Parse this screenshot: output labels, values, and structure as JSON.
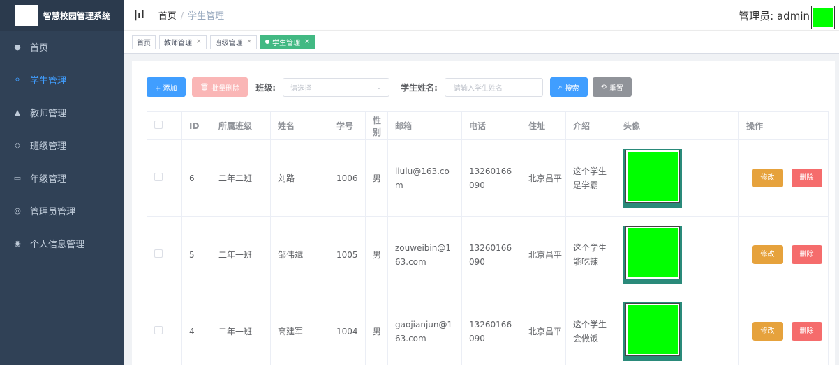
{
  "sidebar": {
    "app_title": "智慧校园管理系统",
    "items": [
      {
        "label": "首页",
        "icon": "dashboard-icon"
      },
      {
        "label": "学生管理",
        "icon": "user-icon"
      },
      {
        "label": "教师管理",
        "icon": "people-icon"
      },
      {
        "label": "班级管理",
        "icon": "tag-icon"
      },
      {
        "label": "年级管理",
        "icon": "calendar-icon"
      },
      {
        "label": "管理员管理",
        "icon": "peoples-icon"
      },
      {
        "label": "个人信息管理",
        "icon": "info-icon"
      }
    ]
  },
  "header": {
    "breadcrumb_home": "首页",
    "breadcrumb_sep": "/",
    "breadcrumb_current": "学生管理",
    "admin_label": "管理员: admin"
  },
  "tags": [
    {
      "label": "首页"
    },
    {
      "label": "教师管理"
    },
    {
      "label": "班级管理"
    },
    {
      "label": "学生管理"
    }
  ],
  "toolbar": {
    "add_label": "+ 添加",
    "batch_delete_label": "批量删除",
    "class_label": "班级:",
    "class_placeholder": "请选择",
    "name_label": "学生姓名:",
    "name_placeholder": "请输入学生姓名",
    "search_label": "搜索",
    "reset_label": "重置"
  },
  "table": {
    "headers": [
      "ID",
      "所属班级",
      "姓名",
      "学号",
      "性别",
      "邮箱",
      "电话",
      "住址",
      "介绍",
      "头像",
      "操作"
    ],
    "rows": [
      {
        "id": "6",
        "class": "二年二班",
        "name": "刘路",
        "number": "1006",
        "gender": "男",
        "email": "liulu@163.com",
        "phone": "13260166090",
        "address": "北京昌平",
        "intro": "这个学生是学霸"
      },
      {
        "id": "5",
        "class": "二年一班",
        "name": "邹伟斌",
        "number": "1005",
        "gender": "男",
        "email": "zouweibin@163.com",
        "phone": "13260166090",
        "address": "北京昌平",
        "intro": "这个学生能吃辣"
      },
      {
        "id": "4",
        "class": "二年一班",
        "name": "高建军",
        "number": "1004",
        "gender": "男",
        "email": "gaojianjun@163.com",
        "phone": "13260166090",
        "address": "北京昌平",
        "intro": "这个学生会做饭"
      }
    ],
    "edit_label": "修改",
    "delete_label": "删除"
  },
  "colors": {
    "sidebar_bg": "#304156",
    "active": "#409eff",
    "tag_active": "#42b983",
    "avatar": "#00ff00"
  }
}
